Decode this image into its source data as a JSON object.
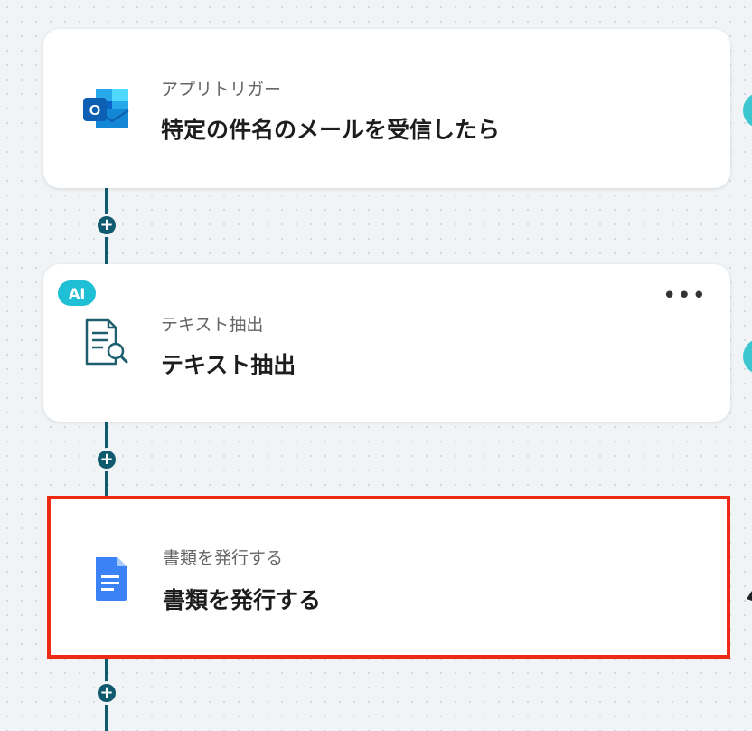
{
  "steps": [
    {
      "subtitle": "アプリトリガー",
      "title": "特定の件名のメールを受信したら",
      "icon": "outlook-icon"
    },
    {
      "badge": "AI",
      "subtitle": "テキスト抽出",
      "title": "テキスト抽出",
      "icon": "text-extract-icon",
      "menu": "•••"
    },
    {
      "subtitle": "書類を発行する",
      "title": "書類を発行する",
      "icon": "google-docs-icon"
    }
  ],
  "add_step_label": "+",
  "colors": {
    "connector": "#0f5a6e",
    "selected_border": "#ee2a14",
    "ai_badge": "#1fbfd6"
  }
}
